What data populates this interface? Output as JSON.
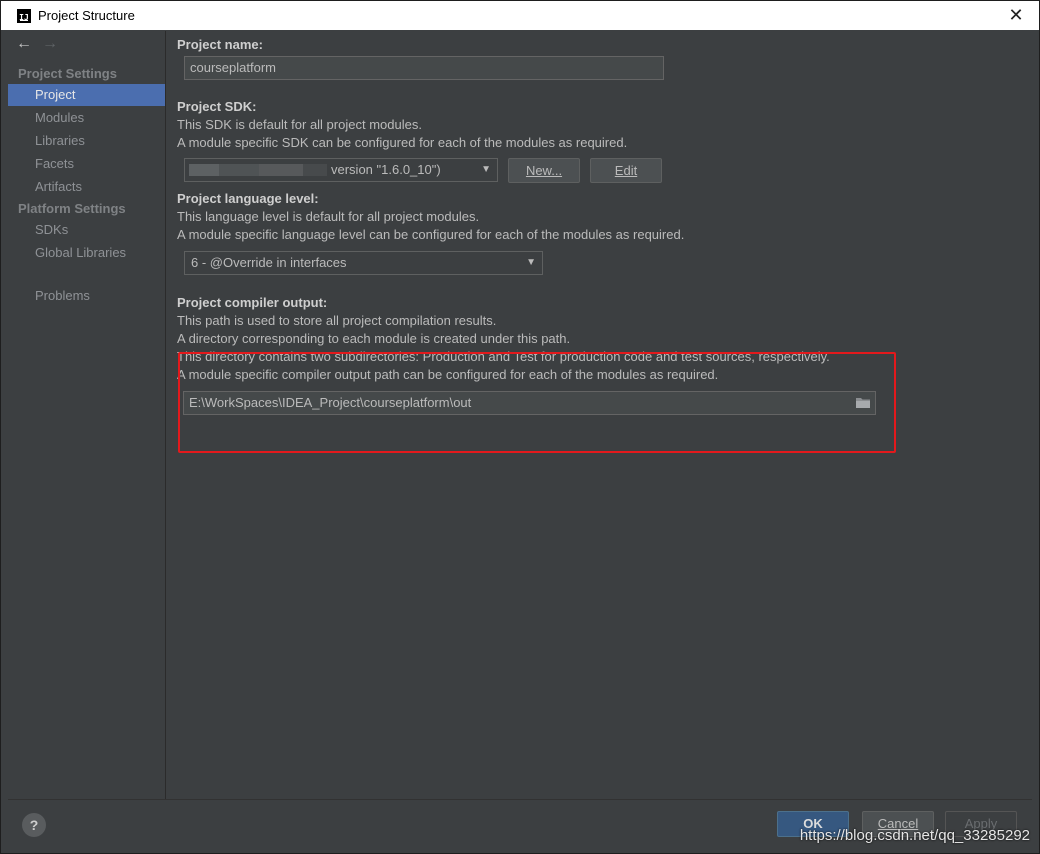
{
  "window": {
    "title": "Project Structure",
    "app_icon_text": "IJ",
    "close_glyph": "✕"
  },
  "sidebar": {
    "back_glyph": "←",
    "forward_glyph": "→",
    "project_settings_heading": "Project Settings",
    "project_settings_items": [
      {
        "label": "Project",
        "selected": true
      },
      {
        "label": "Modules"
      },
      {
        "label": "Libraries"
      },
      {
        "label": "Facets"
      },
      {
        "label": "Artifacts"
      }
    ],
    "platform_settings_heading": "Platform Settings",
    "platform_settings_items": [
      {
        "label": "SDKs"
      },
      {
        "label": "Global Libraries"
      }
    ],
    "problems_label": "Problems"
  },
  "main": {
    "project_name": {
      "label": "Project name:",
      "value": "courseplatform"
    },
    "project_sdk": {
      "label": "Project SDK:",
      "desc1": "This SDK is default for all project modules.",
      "desc2": "A module specific SDK can be configured for each of the modules as required.",
      "selected_value": "version \"1.6.0_10\")",
      "new_button": "New...",
      "edit_button": "Edit"
    },
    "language_level": {
      "label": "Project language level:",
      "desc1": "This language level is default for all project modules.",
      "desc2": "A module specific language level can be configured for each of the modules as required.",
      "selected_value": "6 - @Override in interfaces"
    },
    "compiler_output": {
      "label": "Project compiler output:",
      "desc1": "This path is used to store all project compilation results.",
      "desc2": "A directory corresponding to each module is created under this path.",
      "desc3": "This directory contains two subdirectories: Production and Test for production code and test sources, respectively.",
      "desc4": "A module specific compiler output path can be configured for each of the modules as required.",
      "path_value": "E:\\WorkSpaces\\IDEA_Project\\courseplatform\\out"
    }
  },
  "footer": {
    "help_label": "?",
    "ok_label": "OK",
    "cancel_label": "Cancel",
    "apply_label": "Apply",
    "watermark": "https://blog.csdn.net/qq_33285292"
  },
  "colors": {
    "background": "#3c3f41",
    "selection": "#4b6eaf",
    "highlight_box": "#e3191c",
    "ok_button": "#365880"
  }
}
